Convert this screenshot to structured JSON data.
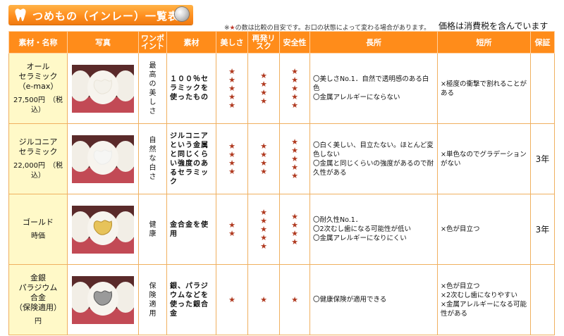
{
  "title": "つめもの（インレー）一覧表",
  "note": {
    "prefix": "※",
    "star": "★",
    "text": "の数は比較の目安です。お口の状態によって変わる場合があります。"
  },
  "tax_note": "価格は消費税を含んでいます",
  "headers": [
    "素材・名称",
    "写真",
    "ワンポイント",
    "素材",
    "美しさ",
    "再発リスク",
    "安全性",
    "長所",
    "短所",
    "保証"
  ],
  "colors": {
    "orange": "#ff8c1a",
    "name_bg": "#fff9c8",
    "star": "#b03a20"
  },
  "rows": [
    {
      "name": [
        "オール",
        "セラミック",
        "（e-max）"
      ],
      "price": "27,500円　（税込）",
      "photo": "ceramic-tooth-photo",
      "point": "最高の美しさ",
      "material": "１００％セラミックを使ったもの",
      "beauty": 5,
      "risk": 4,
      "safety": 5,
      "merits": [
        "〇美しさNo.1．自然で透明感のある白色",
        "〇金属アレルギーにならない"
      ],
      "demerits": [
        "×極度の衝撃で割れることがある"
      ],
      "warranty": ""
    },
    {
      "name": [
        "ジルコニア",
        "セラミック"
      ],
      "price": "22,000円　（税込）",
      "photo": "zirconia-tooth-photo",
      "point": "自然な白さ",
      "material": "ジルコニアという金属と同じくらい強度のあるセラミック",
      "beauty": 4,
      "risk": 4,
      "safety": 5,
      "merits": [
        "〇白く美しい、目立たない。ほとんど変色しない",
        "〇金属と同じくらいの強度があるので耐久性がある"
      ],
      "demerits": [
        "×単色なのでグラデーションがない"
      ],
      "warranty": "3年"
    },
    {
      "name": [
        "ゴールド"
      ],
      "price": "時価",
      "photo": "gold-tooth-photo",
      "point": "健康",
      "material": "金合金を使用",
      "beauty": 2,
      "risk": 5,
      "safety": 4,
      "merits": [
        "〇耐久性No.1．",
        "〇2次むし歯になる可能性が低い",
        "〇金属アレルギーになりにくい"
      ],
      "demerits": [
        "×色が目立つ"
      ],
      "warranty": "3年"
    },
    {
      "name": [
        "金銀",
        "パラジウム",
        "合金",
        "（保険適用）"
      ],
      "price": "円",
      "photo": "palladium-tooth-photo",
      "point": "保険適用",
      "material": "銀、パラジウムなどを使った銀合金",
      "beauty": 1,
      "risk": 1,
      "safety": 1,
      "merits": [
        "〇健康保険が適用できる"
      ],
      "demerits": [
        "×色が目立つ",
        "×2次むし歯になりやすい",
        "×金属アレルギーになる可能性がある"
      ],
      "warranty": ""
    }
  ]
}
